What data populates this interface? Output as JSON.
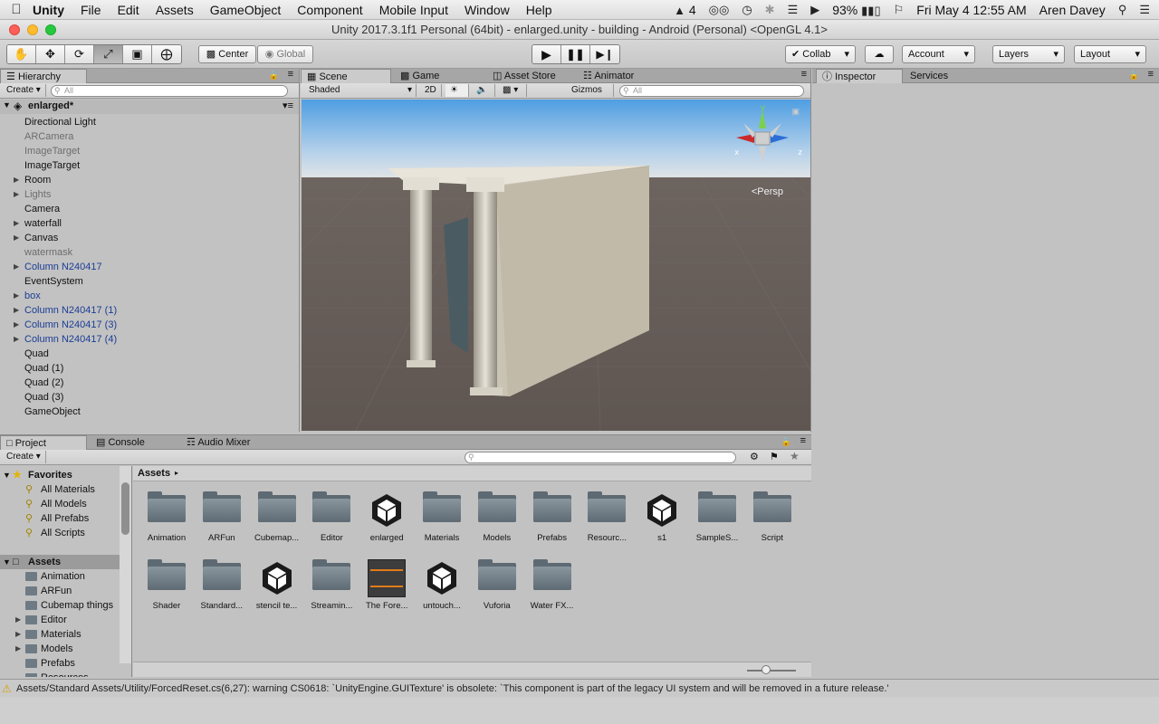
{
  "menubar": {
    "app": "Unity",
    "items": [
      "File",
      "Edit",
      "Assets",
      "GameObject",
      "Component",
      "Mobile Input",
      "Window",
      "Help"
    ],
    "status": {
      "adobe_count": "4",
      "battery": "93%",
      "datetime": "Fri May 4  12:55 AM",
      "user": "Aren Davey"
    }
  },
  "window": {
    "title": "Unity 2017.3.1f1 Personal (64bit) - enlarged.unity - building - Android (Personal) <OpenGL 4.1>"
  },
  "toolbar": {
    "pivot": "Center",
    "space": "Global",
    "collab": "Collab",
    "account": "Account",
    "layers": "Layers",
    "layout": "Layout"
  },
  "hierarchy": {
    "tab": "Hierarchy",
    "create": "Create",
    "search_placeholder": "All",
    "scene": "enlarged*",
    "items": [
      {
        "label": "Directional Light",
        "color": "black",
        "expandable": false
      },
      {
        "label": "ARCamera",
        "color": "gray",
        "expandable": false
      },
      {
        "label": "ImageTarget",
        "color": "gray",
        "expandable": false
      },
      {
        "label": "ImageTarget",
        "color": "black",
        "expandable": false
      },
      {
        "label": "Room",
        "color": "black",
        "expandable": true
      },
      {
        "label": "Lights",
        "color": "gray",
        "expandable": true
      },
      {
        "label": "Camera",
        "color": "black",
        "expandable": false
      },
      {
        "label": "waterfall",
        "color": "black",
        "expandable": true
      },
      {
        "label": "Canvas",
        "color": "black",
        "expandable": true
      },
      {
        "label": "watermask",
        "color": "gray",
        "expandable": false
      },
      {
        "label": "Column N240417",
        "color": "blue",
        "expandable": true
      },
      {
        "label": "EventSystem",
        "color": "black",
        "expandable": false
      },
      {
        "label": "box",
        "color": "blue",
        "expandable": true
      },
      {
        "label": "Column N240417 (1)",
        "color": "blue",
        "expandable": true
      },
      {
        "label": "Column N240417 (3)",
        "color": "blue",
        "expandable": true
      },
      {
        "label": "Column N240417 (4)",
        "color": "blue",
        "expandable": true
      },
      {
        "label": "Quad",
        "color": "black",
        "expandable": false
      },
      {
        "label": "Quad (1)",
        "color": "black",
        "expandable": false
      },
      {
        "label": "Quad (2)",
        "color": "black",
        "expandable": false
      },
      {
        "label": "Quad (3)",
        "color": "black",
        "expandable": false
      },
      {
        "label": "GameObject",
        "color": "black",
        "expandable": false
      }
    ]
  },
  "scene": {
    "tabs": [
      "Scene",
      "Game",
      "Asset Store",
      "Animator"
    ],
    "shading": "Shaded",
    "mode_2d": "2D",
    "gizmos": "Gizmos",
    "search_placeholder": "All",
    "gizmo_y": "y",
    "gizmo_x": "x",
    "gizmo_z": "z",
    "persp": "Persp"
  },
  "inspector": {
    "tabs": [
      "Inspector",
      "Services"
    ]
  },
  "project": {
    "tabs": [
      "Project",
      "Console",
      "Audio Mixer"
    ],
    "create": "Create",
    "favorites_label": "Favorites",
    "favorites": [
      "All Materials",
      "All Models",
      "All Prefabs",
      "All Scripts"
    ],
    "assets_label": "Assets",
    "asset_tree": [
      "Animation",
      "ARFun",
      "Cubemap things",
      "Editor",
      "Materials",
      "Models",
      "Prefabs",
      "Resources"
    ],
    "breadcrumb": "Assets",
    "grid_items": [
      {
        "label": "Animation",
        "kind": "folder"
      },
      {
        "label": "ARFun",
        "kind": "folder"
      },
      {
        "label": "Cubemap...",
        "kind": "folder"
      },
      {
        "label": "Editor",
        "kind": "folder"
      },
      {
        "label": "enlarged",
        "kind": "unity"
      },
      {
        "label": "Materials",
        "kind": "folder"
      },
      {
        "label": "Models",
        "kind": "folder"
      },
      {
        "label": "Prefabs",
        "kind": "folder"
      },
      {
        "label": "Resourc...",
        "kind": "folder"
      },
      {
        "label": "s1",
        "kind": "unity"
      },
      {
        "label": "SampleS...",
        "kind": "folder"
      },
      {
        "label": "Script",
        "kind": "folder"
      },
      {
        "label": "Shader",
        "kind": "folder"
      },
      {
        "label": "Standard...",
        "kind": "folder"
      },
      {
        "label": "stencil te...",
        "kind": "unity"
      },
      {
        "label": "Streamin...",
        "kind": "folder"
      },
      {
        "label": "The Fore...",
        "kind": "texture"
      },
      {
        "label": "untouch...",
        "kind": "unity"
      },
      {
        "label": "Vuforia",
        "kind": "folder"
      },
      {
        "label": "Water FX...",
        "kind": "folder"
      }
    ]
  },
  "status": {
    "message": "Assets/Standard Assets/Utility/ForcedReset.cs(6,27): warning CS0618: `UnityEngine.GUITexture' is obsolete: `This component is part of the legacy UI system and will be removed in a future release.'"
  }
}
